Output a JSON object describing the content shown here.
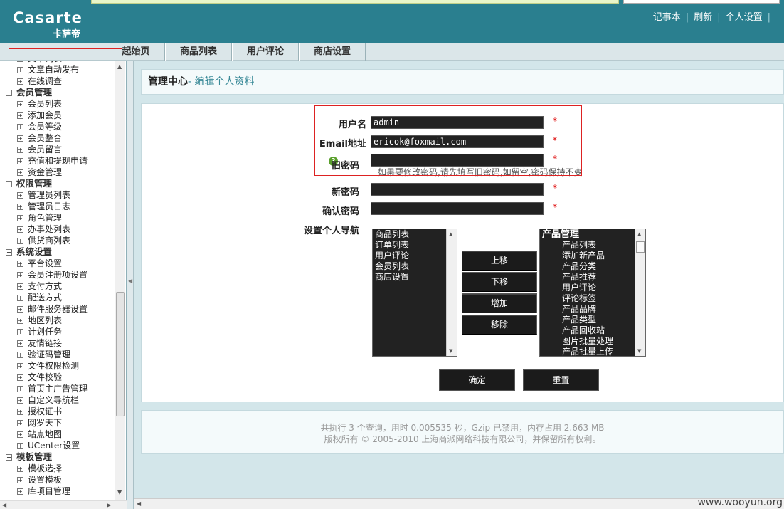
{
  "header": {
    "logo_en": "Casarte",
    "logo_cn": "卡萨帝",
    "links": [
      "记事本",
      "刷新",
      "个人设置"
    ]
  },
  "nav": {
    "tabs": [
      "起始页",
      "商品列表",
      "用户评论",
      "商店设置"
    ]
  },
  "sidebar": {
    "rows": [
      {
        "type": "item",
        "label": "文章列表"
      },
      {
        "type": "item",
        "label": "文章自动发布"
      },
      {
        "type": "item",
        "label": "在线调查"
      },
      {
        "type": "group",
        "label": "会员管理"
      },
      {
        "type": "item",
        "label": "会员列表"
      },
      {
        "type": "item",
        "label": "添加会员"
      },
      {
        "type": "item",
        "label": "会员等级"
      },
      {
        "type": "item",
        "label": "会员整合"
      },
      {
        "type": "item",
        "label": "会员留言"
      },
      {
        "type": "item",
        "label": "充值和提现申请"
      },
      {
        "type": "item",
        "label": "资金管理"
      },
      {
        "type": "group",
        "label": "权限管理"
      },
      {
        "type": "item",
        "label": "管理员列表"
      },
      {
        "type": "item",
        "label": "管理员日志"
      },
      {
        "type": "item",
        "label": "角色管理"
      },
      {
        "type": "item",
        "label": "办事处列表"
      },
      {
        "type": "item",
        "label": "供货商列表"
      },
      {
        "type": "group",
        "label": "系统设置"
      },
      {
        "type": "item",
        "label": "平台设置"
      },
      {
        "type": "item",
        "label": "会员注册项设置"
      },
      {
        "type": "item",
        "label": "支付方式"
      },
      {
        "type": "item",
        "label": "配送方式"
      },
      {
        "type": "item",
        "label": "邮件服务器设置"
      },
      {
        "type": "item",
        "label": "地区列表"
      },
      {
        "type": "item",
        "label": "计划任务"
      },
      {
        "type": "item",
        "label": "友情链接"
      },
      {
        "type": "item",
        "label": "验证码管理"
      },
      {
        "type": "item",
        "label": "文件权限检测"
      },
      {
        "type": "item",
        "label": "文件校验"
      },
      {
        "type": "item",
        "label": "首页主广告管理"
      },
      {
        "type": "item",
        "label": "自定义导航栏"
      },
      {
        "type": "item",
        "label": "授权证书"
      },
      {
        "type": "item",
        "label": "网罗天下"
      },
      {
        "type": "item",
        "label": "站点地图"
      },
      {
        "type": "item",
        "label": "UCenter设置"
      },
      {
        "type": "group",
        "label": "模板管理"
      },
      {
        "type": "item",
        "label": "模板选择"
      },
      {
        "type": "item",
        "label": "设置模板"
      },
      {
        "type": "item",
        "label": "库项目管理"
      }
    ]
  },
  "page": {
    "title": "管理中心",
    "subtitle": "- 编辑个人资料"
  },
  "form": {
    "username_label": "用户名",
    "username_value": "admin",
    "email_label": "Email地址",
    "email_value": "ericok@foxmail.com",
    "old_password_label": "旧密码",
    "old_password_hint": "如果要修改密码,请先填写旧密码,如留空,密码保持不变",
    "new_password_label": "新密码",
    "confirm_password_label": "确认密码",
    "required_mark": "*",
    "nav_label": "设置个人导航",
    "help_icon_glyph": "?",
    "current_nav": [
      "商品列表",
      "订单列表",
      "用户评论",
      "会员列表",
      "商店设置"
    ],
    "all_menus": [
      {
        "type": "grp",
        "label": "产品管理"
      },
      {
        "type": "sub",
        "label": "产品列表"
      },
      {
        "type": "sub",
        "label": "添加新产品"
      },
      {
        "type": "sub",
        "label": "产品分类"
      },
      {
        "type": "sub",
        "label": "产品推荐"
      },
      {
        "type": "sub",
        "label": "用户评论"
      },
      {
        "type": "sub",
        "label": "评论标签"
      },
      {
        "type": "sub",
        "label": "产品品牌"
      },
      {
        "type": "sub",
        "label": "产品类型"
      },
      {
        "type": "sub",
        "label": "产品回收站"
      },
      {
        "type": "sub",
        "label": "图片批量处理"
      },
      {
        "type": "sub",
        "label": "产品批量上传"
      }
    ],
    "btn_up": "上移",
    "btn_down": "下移",
    "btn_add": "增加",
    "btn_remove": "移除",
    "btn_submit": "确定",
    "btn_reset": "重置"
  },
  "footer": {
    "line1": "共执行 3 个查询，用时 0.005535 秒，Gzip 已禁用，内存占用 2.663 MB",
    "line2": "版权所有 © 2005-2010 上海商派网络科技有限公司，并保留所有权利。"
  },
  "watermark": "www.wooyun.org",
  "colors": {
    "header_bg": "#2a7f8f",
    "main_bg": "#d3e6ea",
    "input_bg": "#222222",
    "highlight_box": "#dd2222"
  }
}
